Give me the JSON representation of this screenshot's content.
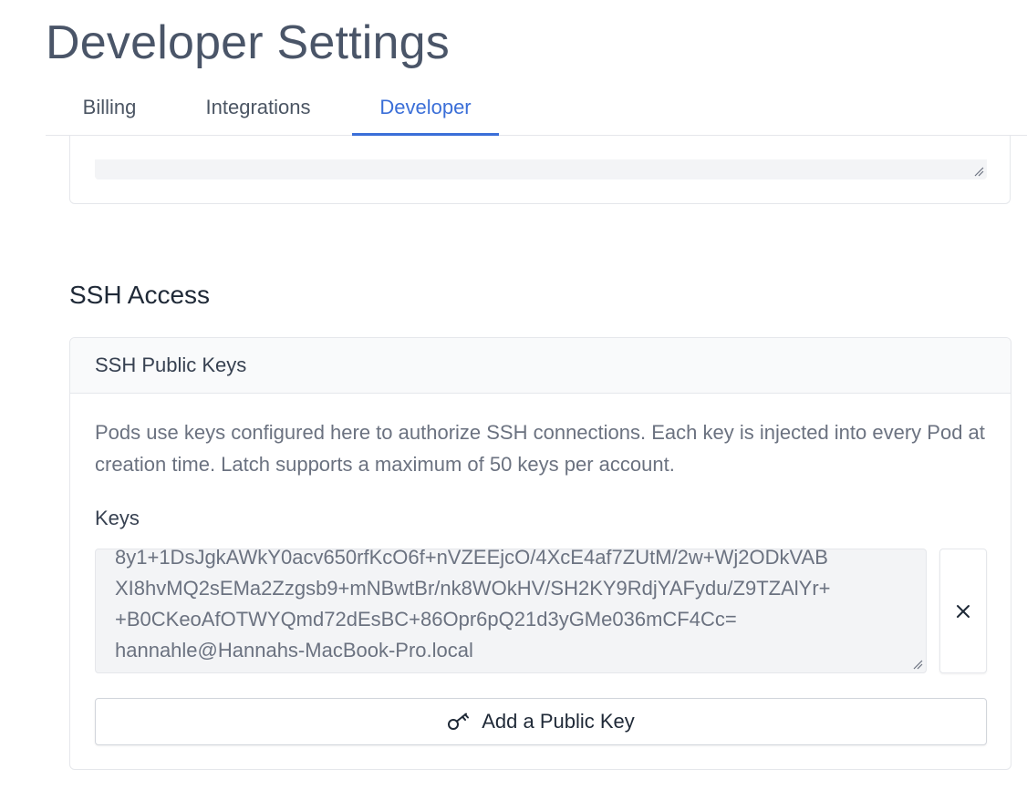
{
  "page": {
    "title": "Developer Settings"
  },
  "tabs": [
    {
      "label": "Billing",
      "active": false
    },
    {
      "label": "Integrations",
      "active": false
    },
    {
      "label": "Developer",
      "active": true
    }
  ],
  "ssh": {
    "section_title": "SSH Access",
    "card_title": "SSH Public Keys",
    "description": "Pods use keys configured here to authorize SSH connections. Each key is injected into every Pod at creation time. Latch supports a maximum of 50 keys per account.",
    "keys_label": "Keys",
    "key_value": "8y1+1DsJgkAWkY0acv650rfKcO6f+nVZEEjcO/4XcE4af7ZUtM/2w+Wj2ODkVAB\nXI8hvMQ2sEMa2Zzgsb9+mNBwtBr/nk8WOkHV/SH2KY9RdjYAFydu/Z9TZAlYr+\n+B0CKeoAfOTWYQmd72dEsBC+86Opr6pQ21d3yGMe036mCF4Cc=\nhannahle@Hannahs-MacBook-Pro.local",
    "remove_icon": "close-icon",
    "add_button_label": "Add a Public Key",
    "add_button_icon": "key-icon"
  },
  "colors": {
    "accent": "#3b6fd8",
    "title": "#4a5568",
    "muted_text": "#6b7280",
    "field_bg": "#f3f4f6",
    "border": "#e5e7eb"
  }
}
